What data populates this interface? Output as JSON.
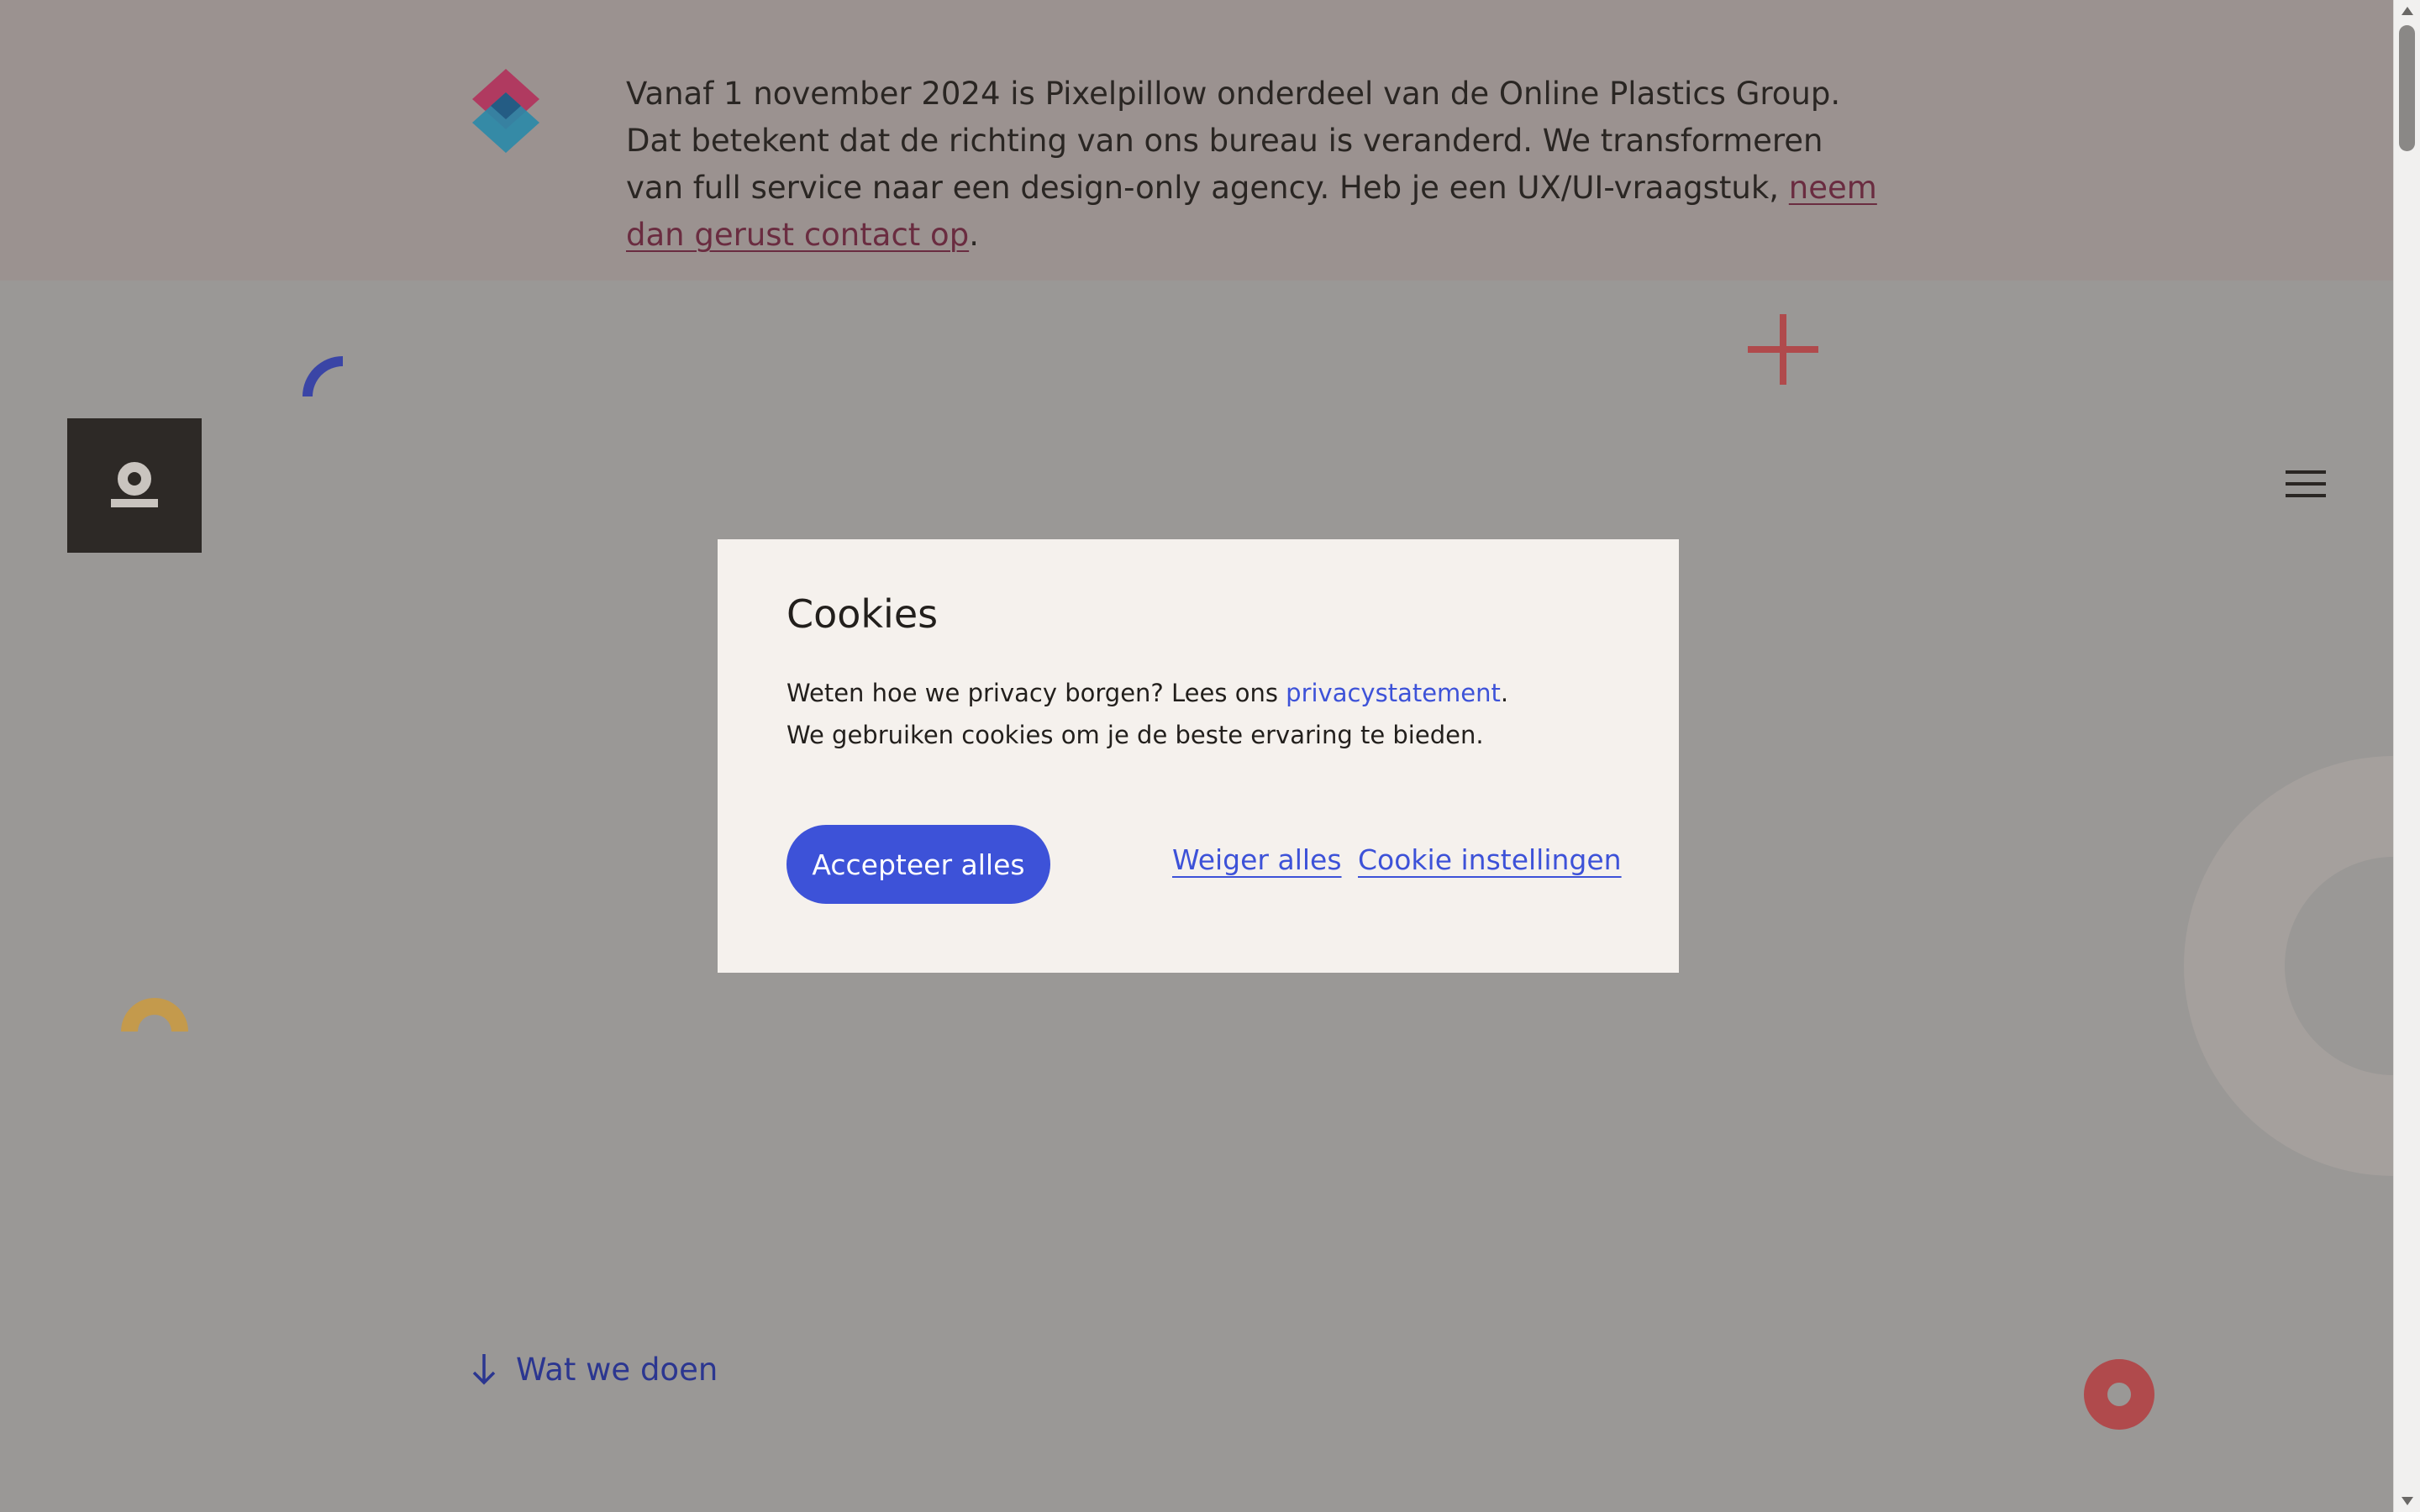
{
  "announcement": {
    "text": "Vanaf 1 november 2024 is Pixelpillow onderdeel van de Online Plastics Group. Dat betekent dat de richting van ons bureau is veranderd. We transformeren van full service naar een design-only agency. Heb je een UX/UI-vraagstuk, ",
    "link_label": "neem dan gerust contact op",
    "end": "."
  },
  "hero": {
    "scroll_label": "Wat we doen"
  },
  "cookie_modal": {
    "title": "Cookies",
    "line1_prefix": "Weten hoe we privacy borgen? Lees ons ",
    "privacy_link": "privacystatement",
    "line1_suffix": ".",
    "line2": "We gebruiken cookies om je de beste ervaring te bieden.",
    "accept_label": "Accepteer alles",
    "reject_label": "Weiger alles",
    "settings_label": "Cookie instellingen"
  },
  "colors": {
    "overlay_bg": "#9a9896",
    "modal_bg": "#f5f1ed",
    "accent_blue": "#3d52d8",
    "link_maroon": "#6a2c40",
    "shape_red": "#b04a4c",
    "shape_yellow": "#c49a4c",
    "shape_indigo": "#3a45a6"
  },
  "icons": [
    "diamond-logo-icon",
    "brand-logo-icon",
    "hamburger-menu-icon",
    "arrow-down-icon",
    "plus-shape-icon",
    "arc-shape-icon",
    "half-ring-shape-icon",
    "ring-shape-icon"
  ]
}
